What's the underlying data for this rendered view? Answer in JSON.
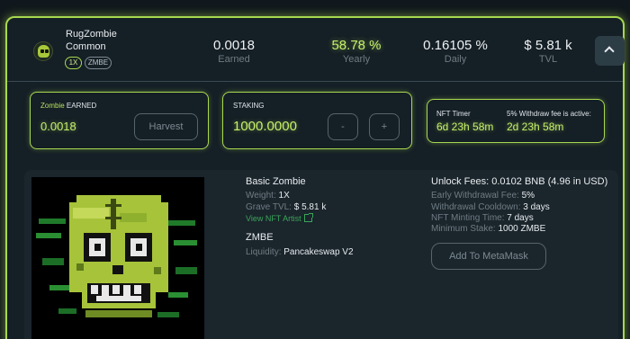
{
  "header": {
    "pool_name": "RugZombie",
    "rarity": "Common",
    "badges": [
      "1X",
      "ZMBE"
    ],
    "stats": {
      "earned": {
        "value": "0.0018",
        "label": "Earned"
      },
      "yearly": {
        "value": "58.78 %",
        "label": "Yearly"
      },
      "daily": {
        "value": "0.16105 %",
        "label": "Daily"
      },
      "tvl": {
        "value": "$ 5.81 k",
        "label": "TVL"
      }
    },
    "toggle_icon": "chevron-up-icon"
  },
  "earn_card": {
    "title_accent": "Zombie",
    "title_rest": " EARNED",
    "amount": "0.0018",
    "harvest_label": "Harvest"
  },
  "stake_card": {
    "title": "STAKING",
    "amount": "1000.0000",
    "minus_label": "-",
    "plus_label": "+"
  },
  "timer_card": {
    "nft_timer_label": "NFT Timer",
    "nft_timer_value": "6d 23h 58m",
    "withdraw_label": "5% Withdraw fee is active:",
    "withdraw_value": "2d 23h 58m"
  },
  "details": {
    "nft_name": "Basic Zombie",
    "weight_label": "Weight:",
    "weight_value": "1X",
    "grave_tvl_label": "Grave TVL:",
    "grave_tvl_value": "$ 5.81 k",
    "artist_link": "View NFT Artist",
    "token": "ZMBE",
    "liquidity_label": "Liquidity:",
    "liquidity_value": "Pancakeswap V2",
    "unlock_fees": "Unlock Fees: 0.0102 BNB (4.96 in USD)",
    "early_fee_label": "Early Withdrawal Fee:",
    "early_fee_value": "5%",
    "cooldown_label": "Withdrawal Cooldown:",
    "cooldown_value": "3 days",
    "minting_label": "NFT Minting Time:",
    "minting_value": "7 days",
    "min_stake_label": "Minimum Stake:",
    "min_stake_value": "1000 ZMBE",
    "metamask_label": "Add To MetaMask"
  },
  "colors": {
    "accent": "#a7d84f",
    "accent_text": "#c6ef6a",
    "link": "#3aa65a",
    "background": "#11181d"
  }
}
